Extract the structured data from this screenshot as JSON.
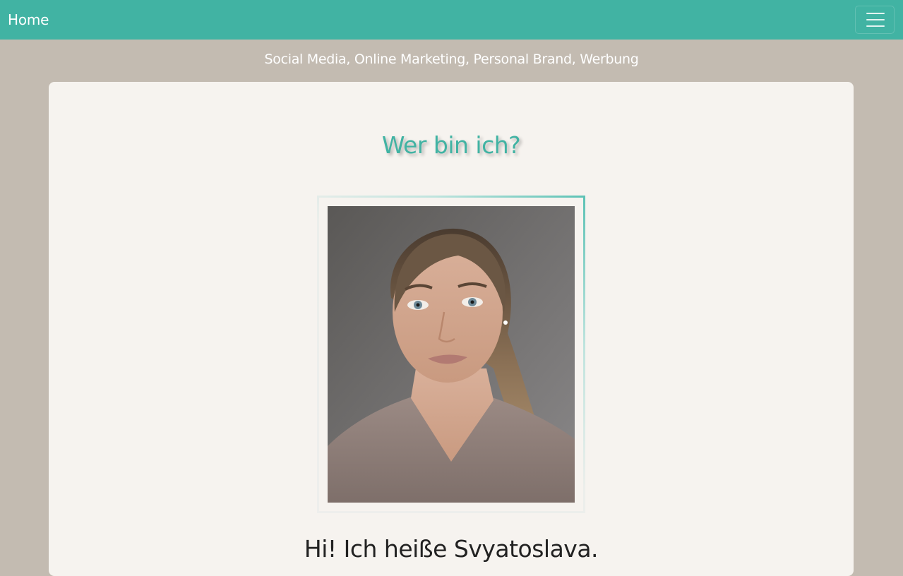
{
  "navbar": {
    "brand": "Home",
    "menu_icon": "hamburger-menu-icon"
  },
  "header": {
    "tagline": "Social Media, Online Marketing, Personal Brand, Werbung"
  },
  "main": {
    "title": "Wer bin ich?",
    "intro": "Hi! Ich heiße Svyatoslava."
  },
  "colors": {
    "accent": "#41b3a3",
    "background": "#c3bbb1",
    "card": "#f6f3ef",
    "text": "#222222"
  }
}
